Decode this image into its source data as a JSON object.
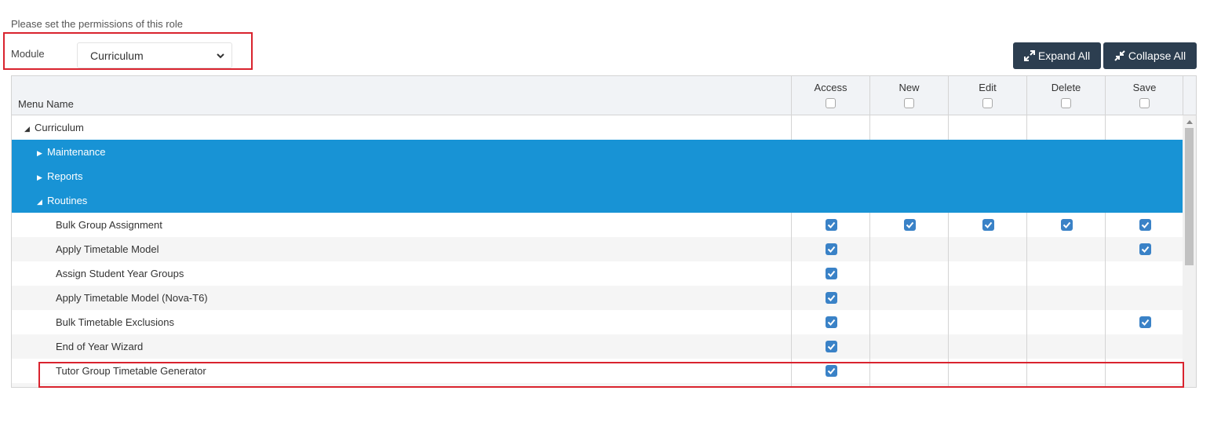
{
  "intro": "Please set the permissions of this role",
  "module": {
    "label": "Module",
    "selected": "Curriculum"
  },
  "buttons": {
    "expand": "Expand All",
    "collapse": "Collapse All"
  },
  "colors": {
    "primary_button": "#2c3e50",
    "selected_row": "#1893d5",
    "checkbox": "#3a82c7",
    "highlight": "#d9232e"
  },
  "table": {
    "name_header": "Menu Name",
    "columns": [
      "Access",
      "New",
      "Edit",
      "Delete",
      "Save"
    ],
    "rows": [
      {
        "label": "Curriculum",
        "depth": 0,
        "expander": "◢",
        "selected": false,
        "alt": false,
        "checks": [
          false,
          false,
          false,
          false,
          false
        ]
      },
      {
        "label": "Maintenance",
        "depth": 1,
        "expander": "▶",
        "selected": true,
        "alt": false,
        "checks": [
          false,
          false,
          false,
          false,
          false
        ]
      },
      {
        "label": "Reports",
        "depth": 1,
        "expander": "▶",
        "selected": true,
        "alt": false,
        "checks": [
          false,
          false,
          false,
          false,
          false
        ]
      },
      {
        "label": "Routines",
        "depth": 1,
        "expander": "◢",
        "selected": true,
        "alt": false,
        "checks": [
          false,
          false,
          false,
          false,
          false
        ]
      },
      {
        "label": "Bulk Group Assignment",
        "depth": 2,
        "expander": "",
        "selected": false,
        "alt": false,
        "checks": [
          true,
          true,
          true,
          true,
          true
        ]
      },
      {
        "label": "Apply Timetable Model",
        "depth": 2,
        "expander": "",
        "selected": false,
        "alt": true,
        "checks": [
          true,
          false,
          false,
          false,
          true
        ]
      },
      {
        "label": "Assign Student Year Groups",
        "depth": 2,
        "expander": "",
        "selected": false,
        "alt": false,
        "checks": [
          true,
          false,
          false,
          false,
          false
        ]
      },
      {
        "label": "Apply Timetable Model (Nova-T6)",
        "depth": 2,
        "expander": "",
        "selected": false,
        "alt": true,
        "checks": [
          true,
          false,
          false,
          false,
          false
        ]
      },
      {
        "label": "Bulk Timetable Exclusions",
        "depth": 2,
        "expander": "",
        "selected": false,
        "alt": false,
        "checks": [
          true,
          false,
          false,
          false,
          true
        ]
      },
      {
        "label": "End of Year Wizard",
        "depth": 2,
        "expander": "",
        "selected": false,
        "alt": true,
        "checks": [
          true,
          false,
          false,
          false,
          false
        ]
      },
      {
        "label": "Tutor Group Timetable Generator",
        "depth": 2,
        "expander": "",
        "selected": false,
        "alt": false,
        "checks": [
          true,
          false,
          false,
          false,
          false
        ]
      },
      {
        "label": "",
        "depth": 2,
        "expander": "",
        "selected": false,
        "alt": true,
        "checks": [
          false,
          false,
          false,
          false,
          false
        ]
      }
    ]
  }
}
